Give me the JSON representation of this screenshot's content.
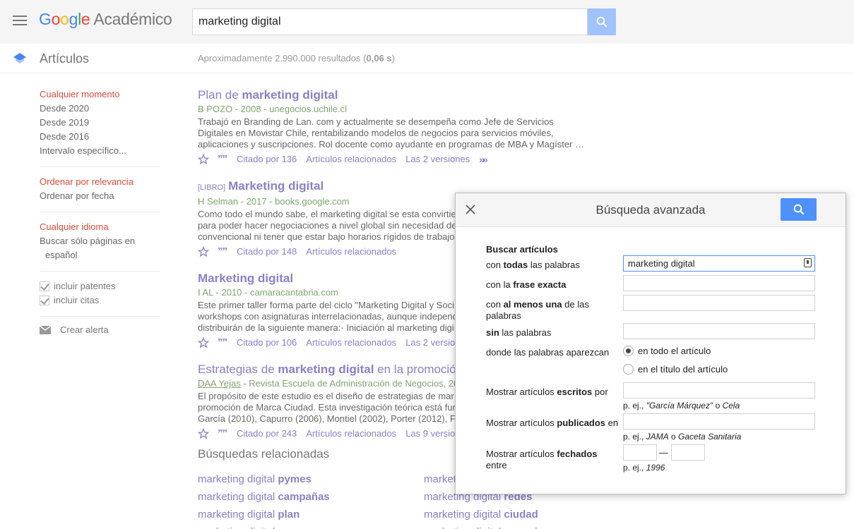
{
  "header": {
    "logo_google": "Google",
    "logo_product": "Académico",
    "search_value": "marketing digital"
  },
  "subheader": {
    "section": "Artículos",
    "results_prefix": "Aproximadamente 2.990.000 resultados (",
    "results_time": "0,06 s",
    "results_suffix": ")"
  },
  "sidebar": {
    "time": [
      "Cualquier momento",
      "Desde 2020",
      "Desde 2019",
      "Desde 2016",
      "Intervalo específico..."
    ],
    "sort": [
      "Ordenar por relevancia",
      "Ordenar por fecha"
    ],
    "language": [
      "Cualquier idioma",
      "Buscar sólo páginas en",
      "español"
    ],
    "checks": [
      "incluir patentes",
      "incluir citas"
    ],
    "alert": "Crear alerta"
  },
  "results": [
    {
      "tag": "",
      "title_plain": "Plan de ",
      "title_bold": "marketing digital",
      "title_after": "",
      "meta_author": "B POZO",
      "meta_rest": " - 2008 - unegocios.uchile.cl",
      "snippet": [
        "Trabajó en Branding de Lan. com y actualmente se desempeña como Jefe de Servicios",
        "Digitales en Movistar Chile, rentabilizando modelos de negocios para servicios móviles,",
        "aplicaciones y suscripciones. Rol docente como ayudante en programas de MBA y Magíster …"
      ],
      "cited": "Citado por 136",
      "related": "Artículos relacionados",
      "versions": "Las 2 versiones"
    },
    {
      "tag": "[LIBRO]",
      "title_plain": "",
      "title_bold": "Marketing digital",
      "title_after": "",
      "meta_author": "H Selman",
      "meta_rest": " - 2017 - books.google.com",
      "snippet": [
        "Como todo el mundo sabe, el marketing digital se esta convirtiendo",
        "para poder hacer negociaciones a nivel global sin necesidad de",
        "convencional ni tener que estar bajo horarios rígidos de trabajo"
      ],
      "cited": "Citado por 148",
      "related": "Artículos relacionados",
      "versions": ""
    },
    {
      "tag": "",
      "title_plain": "",
      "title_bold": "Marketing digital",
      "title_after": "",
      "meta_author": "I AL",
      "meta_rest": " - 2010 - camaracantabria.com",
      "snippet": [
        "Este primer taller forma parte del ciclo \"Marketing Digital y Soci",
        "workshops con asignaturas interrelacionadas, aunque independ",
        "distribuirán de la siguiente manera:· Iniciación al marketing digi"
      ],
      "cited": "Citado por 106",
      "related": "Artículos relacionados",
      "versions": "Las 2 versio"
    },
    {
      "tag": "",
      "title_plain": "Estrategias de ",
      "title_bold": "marketing digital",
      "title_after": " en la promoció",
      "meta_author": "DAA Yejas",
      "meta_rest": " - Revista Escuela de Administración de Negocios, 20",
      "snippet": [
        "El propósito de este estudio es el diseño de estrategias de mar",
        "promoción de Marca Ciudad. Esta investigación teórica está fun",
        "García (2010), Capurro (2006), Montiel (2002), Porter (2012), F"
      ],
      "cited": "Citado por 243",
      "related": "Artículos relacionados",
      "versions": "Las 9 versio"
    }
  ],
  "related_searches": {
    "title": "Búsquedas relacionadas",
    "left": [
      {
        "plain": "marketing digital ",
        "bold": "pymes"
      },
      {
        "plain": "marketing digital ",
        "bold": "campañas"
      },
      {
        "plain": "marketing digital ",
        "bold": "plan"
      },
      {
        "plain": "marketing digital ",
        "bold": "empresa"
      }
    ],
    "right": [
      {
        "plain": "market",
        "bold": ""
      },
      {
        "plain": "marketing digital ",
        "bold": "redes"
      },
      {
        "plain": "marketing digital ",
        "bold": "ciudad"
      },
      {
        "plain": "marketing digital ",
        "bold": "agencia"
      }
    ]
  },
  "advanced": {
    "title": "Búsqueda avanzada",
    "section": "Buscar artículos",
    "all_words_value": "marketing digital",
    "where_all": "en todo el artículo",
    "where_title": "en el título del artículo",
    "author_hint_prefix": "p. ej., ",
    "author_hint_1": "\"García Márquez\"",
    "author_hint_mid": " o ",
    "author_hint_2": "Cela",
    "pub_hint_1": "JAMA",
    "pub_hint_mid": " o ",
    "pub_hint_2": "Gaceta Sanitaria",
    "date_hint_year": "1996",
    "date_dash": "—"
  },
  "colors": {
    "link": "#8c7fca",
    "meta_green": "#7ea670",
    "active_red": "#dd4b39",
    "search_blue": "#4d90fe"
  }
}
